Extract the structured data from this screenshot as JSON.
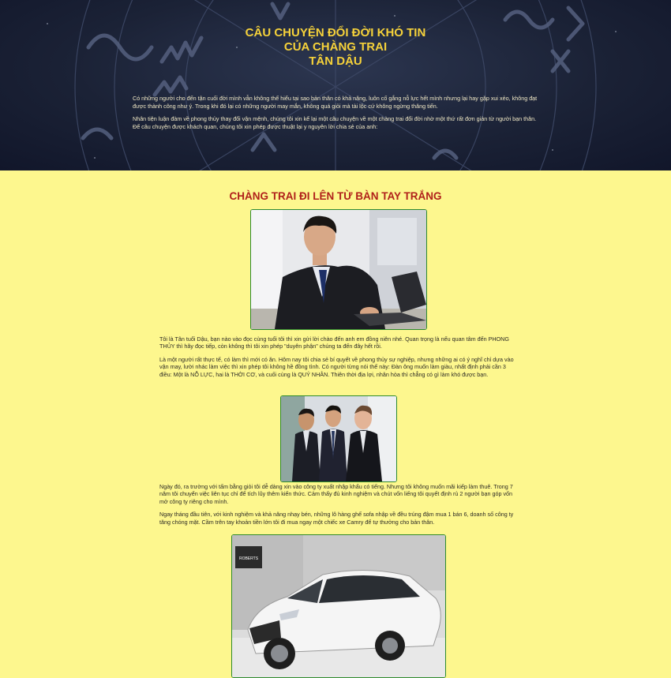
{
  "hero": {
    "title_line1": "CÂU CHUYỆN ĐỔI ĐỜI KHÓ TIN",
    "title_line2": "CỦA CHÀNG TRAI",
    "title_line3": "TÂN DẬU",
    "para1": "Có những người cho đến tận cuối đời mình vẫn không thể hiểu tại sao bản thân có khả năng, luôn cố gắng nỗ lực hết mình nhưng lại hay gặp xui xẻo, không đạt được thành công như ý. Trong khi đó lại có những người may mắn, không quá giỏi mà tài lộc cứ không ngừng thăng tiến.",
    "para2": "Nhân tiện luận đàm về phong thủy thay đổi vận mệnh, chúng tôi xin kể lại một câu chuyện về một chàng trai đổi đời nhờ một thứ rất đơn giản từ người bạn thân. Để câu chuyện được khách quan, chúng tôi xin phép được thuật lại y nguyên lời chia sẻ của anh:"
  },
  "section": {
    "title": "CHÀNG TRAI ĐI LÊN TỪ BÀN TAY TRẮNG"
  },
  "story": {
    "para1": "Tôi là Tân tuổi Dậu, bạn nào vào đọc cùng tuổi tôi thì xin gửi lời chào đến anh em đồng niên nhé. Quan trọng là nếu quan tâm đến PHONG THỦY thì hãy đọc tiếp, còn không thì tôi xin phép \"duyên phận\" chúng ta đến đây hết rồi.",
    "para2": "Là một người rất thực tế, có làm thì mới có ăn. Hôm nay tôi chia sẻ bí quyết về phong thủy sự nghiệp, nhưng những ai có ý nghĩ chỉ dựa vào vận may, lười nhác làm việc thì xin phép tôi không hề đồng tình. Có người từng nói thế này: Đàn ông muốn làm giàu, nhất định phải cần 3 điều: Một là NỖ LỰC, hai là THỜI CƠ, và cuối cùng là QUÝ NHÂN. Thiên thời địa lợi, nhân hòa thì chẳng có gì làm khó được bạn.",
    "para3": "Ngày đó, ra trường với tấm bằng giỏi tôi dễ dàng xin vào công ty xuất nhập khẩu có tiếng. Nhưng tôi không muốn mãi kiếp làm thuê. Trong 7 năm tôi chuyển việc liên tục chỉ để tích lũy thêm kiến thức. Cảm thấy đủ kinh nghiệm và chút vốn liếng tôi quyết định rủ 2 người bạn góp vốn mở công ty riêng cho mình.",
    "para4": "Ngay tháng đầu tiên, với kinh nghiệm và khả năng nhạy bén, những lô hàng ghế sofa nhập về đều trúng đậm mua 1 bán 6, doanh số công ty tăng chóng mặt. Cầm trên tay khoản tiền lớn tôi đi mua ngay một chiếc xe Camry để tự thưởng cho bản thân."
  },
  "photos": {
    "car_dealer_sign": "ROBERTS"
  },
  "colors": {
    "page_bg": "#fdf78e",
    "hero_title": "#f6d23a",
    "section_title": "#b0201a",
    "photo_border": "#2e8a2c"
  }
}
